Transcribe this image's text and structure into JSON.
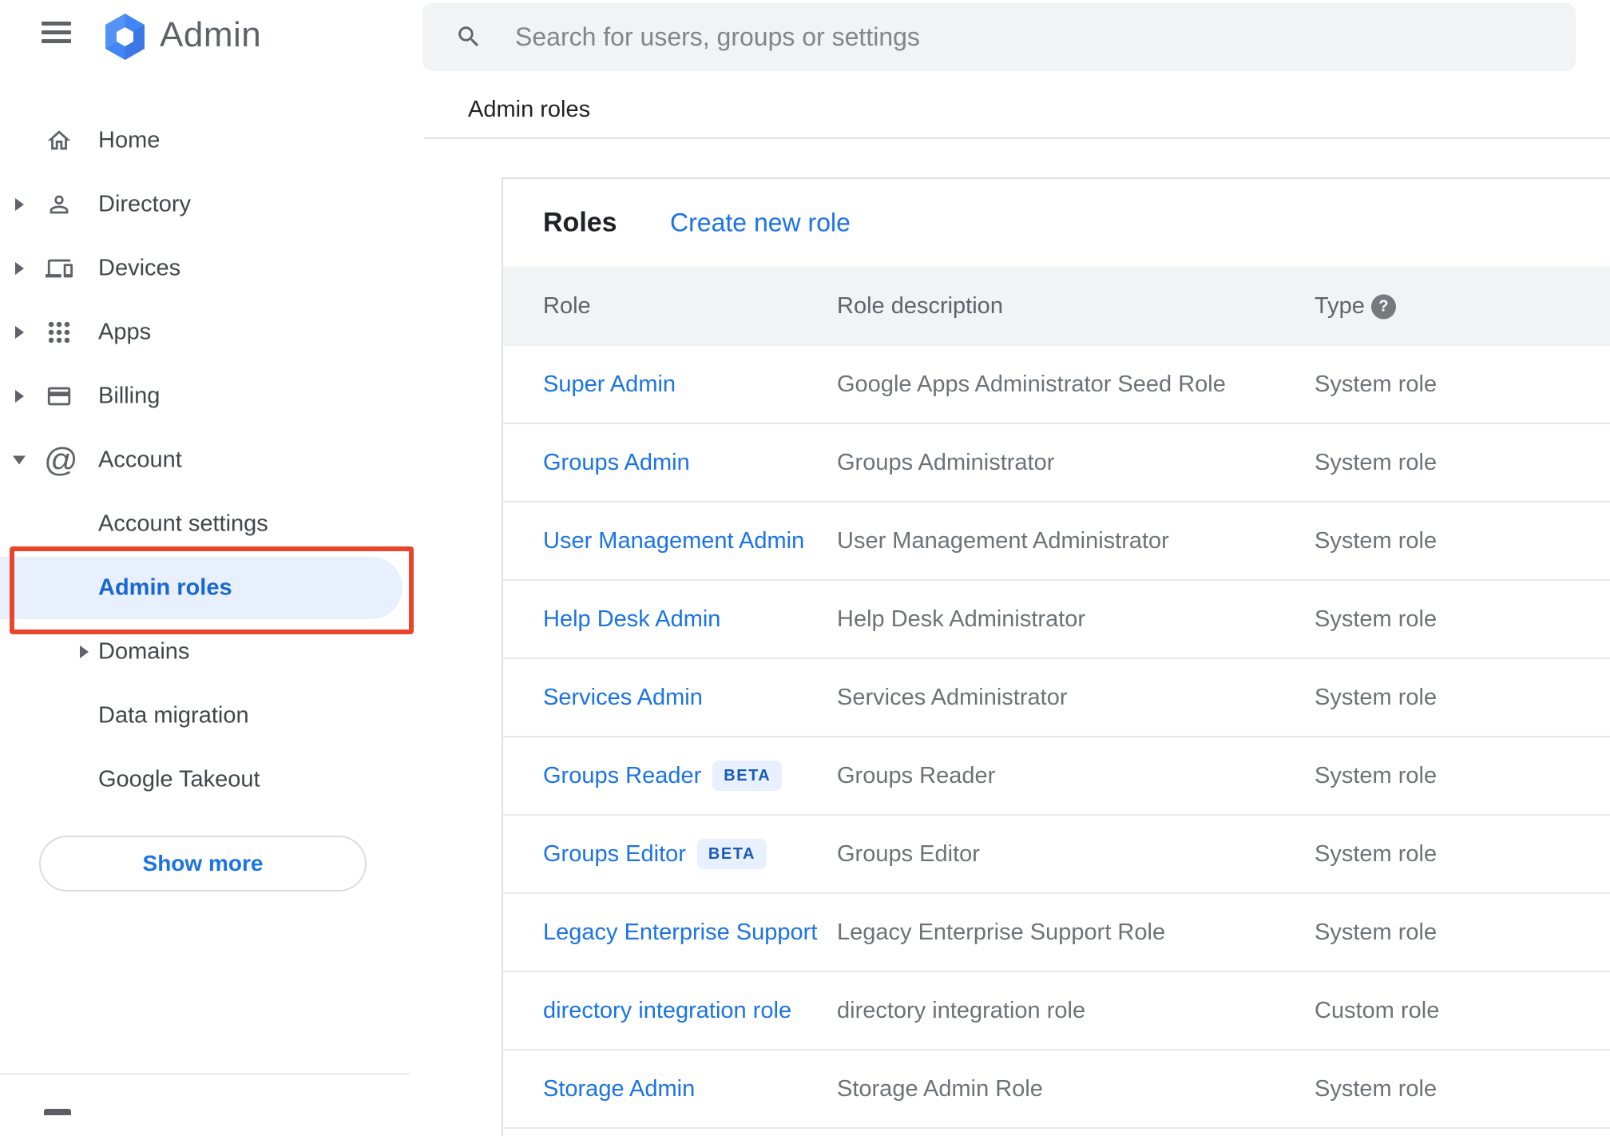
{
  "sidebar": {
    "logo_text": "Admin",
    "items": [
      {
        "label": "Home",
        "icon": "home",
        "caret": null
      },
      {
        "label": "Directory",
        "icon": "person",
        "caret": "right"
      },
      {
        "label": "Devices",
        "icon": "devices",
        "caret": "right"
      },
      {
        "label": "Apps",
        "icon": "apps",
        "caret": "right"
      },
      {
        "label": "Billing",
        "icon": "billing",
        "caret": "right"
      },
      {
        "label": "Account",
        "icon": "at",
        "caret": "down"
      }
    ],
    "sub_items": [
      {
        "label": "Account settings",
        "selected": false,
        "caret": null
      },
      {
        "label": "Admin roles",
        "selected": true,
        "caret": null
      },
      {
        "label": "Domains",
        "selected": false,
        "caret": "right"
      },
      {
        "label": "Data migration",
        "selected": false,
        "caret": null
      },
      {
        "label": "Google Takeout",
        "selected": false,
        "caret": null
      }
    ],
    "show_more_label": "Show more"
  },
  "search": {
    "placeholder": "Search for users, groups or settings"
  },
  "breadcrumb": "Admin roles",
  "roles_card": {
    "title": "Roles",
    "create_link": "Create new role",
    "columns": {
      "role": "Role",
      "description": "Role description",
      "type": "Type"
    },
    "help_glyph": "?",
    "beta_label": "BETA",
    "rows": [
      {
        "role": "Super Admin",
        "beta": false,
        "description": "Google Apps Administrator Seed Role",
        "type": "System role"
      },
      {
        "role": "Groups Admin",
        "beta": false,
        "description": "Groups Administrator",
        "type": "System role"
      },
      {
        "role": "User Management Admin",
        "beta": false,
        "description": "User Management Administrator",
        "type": "System role"
      },
      {
        "role": "Help Desk Admin",
        "beta": false,
        "description": "Help Desk Administrator",
        "type": "System role"
      },
      {
        "role": "Services Admin",
        "beta": false,
        "description": "Services Administrator",
        "type": "System role"
      },
      {
        "role": "Groups Reader",
        "beta": true,
        "description": "Groups Reader",
        "type": "System role"
      },
      {
        "role": "Groups Editor",
        "beta": true,
        "description": "Groups Editor",
        "type": "System role"
      },
      {
        "role": "Legacy Enterprise Support",
        "beta": false,
        "description": "Legacy Enterprise Support Role",
        "type": "System role"
      },
      {
        "role": "directory integration role",
        "beta": false,
        "description": "directory integration role",
        "type": "Custom role"
      },
      {
        "role": "Storage Admin",
        "beta": false,
        "description": "Storage Admin Role",
        "type": "System role"
      }
    ]
  },
  "colors": {
    "accent_blue": "#1a73e8",
    "selected_text_blue": "#1967d2",
    "selected_pill_bg": "#e8f0fe",
    "annotation_red": "#e8452c",
    "beta_text": "#185abc",
    "beta_bg": "#e8f0fe",
    "logo_blue": "#4285f4",
    "icon_gray": "#5f6368",
    "muted_text": "#6e7277",
    "header_bg": "#f2f3f4"
  }
}
